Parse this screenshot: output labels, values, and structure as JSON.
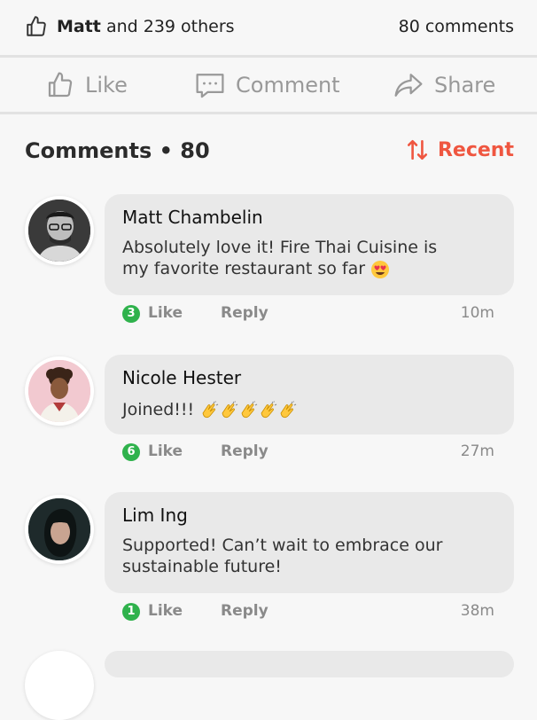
{
  "summary": {
    "liker_name": "Matt",
    "liker_rest": "and 239 others",
    "comment_count_text": "80 comments"
  },
  "actions": {
    "like_label": "Like",
    "comment_label": "Comment",
    "share_label": "Share"
  },
  "comments_header": {
    "title": "Comments • 80",
    "sort_label": "Recent"
  },
  "comments": [
    {
      "name": "Matt Chambelin",
      "text_line1": "Absolutely love it! Fire Thai Cuisine is",
      "text_line2": "my favorite restaurant so far",
      "emoji": "heart-eyes-emoji",
      "likes": "3",
      "like_label": "Like",
      "reply_label": "Reply",
      "time": "10m"
    },
    {
      "name": "Nicole Hester",
      "text_line1": "Joined!!!",
      "emoji": "clapping-hands-emoji x5",
      "likes": "6",
      "like_label": "Like",
      "reply_label": "Reply",
      "time": "27m"
    },
    {
      "name": "Lim Ing",
      "text_line1": "Supported! Can’t wait to embrace our",
      "text_line2": "sustainable future!",
      "likes": "1",
      "like_label": "Like",
      "reply_label": "Reply",
      "time": "38m"
    }
  ],
  "colors": {
    "accent": "#ef5640",
    "badge": "#2fb24c",
    "bubble": "#e9e9e9",
    "background": "#f7f7f7"
  }
}
